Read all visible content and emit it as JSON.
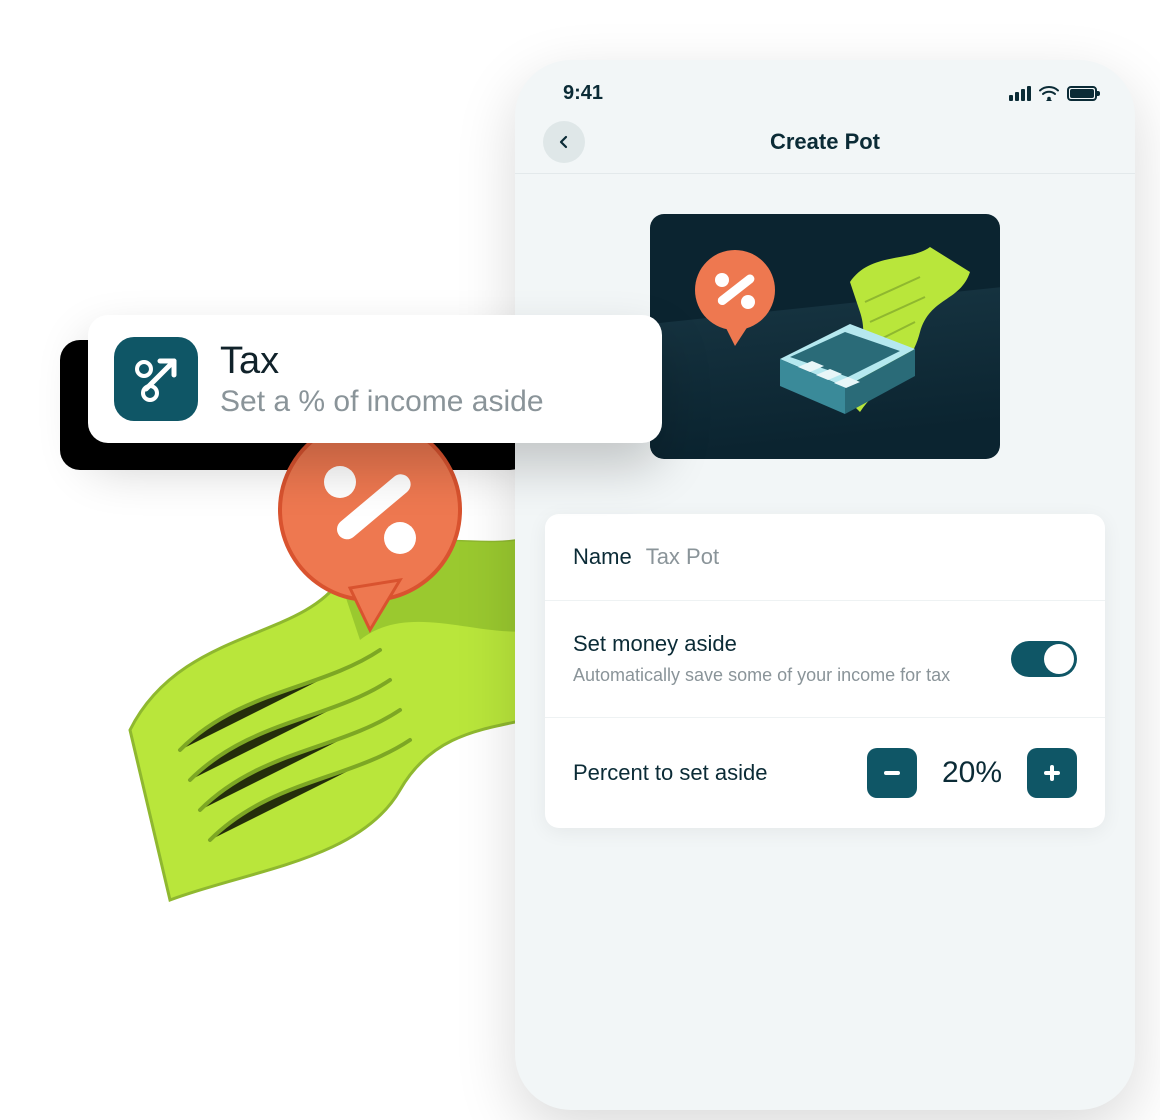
{
  "status": {
    "time": "9:41"
  },
  "nav": {
    "title": "Create Pot"
  },
  "form": {
    "name_label": "Name",
    "name_value": "Tax Pot",
    "aside_title": "Set money aside",
    "aside_sub": "Automatically save some of your income for tax",
    "percent_label": "Percent to set aside",
    "percent_value": "20%"
  },
  "callout": {
    "title": "Tax",
    "subtitle": "Set a % of income aside"
  },
  "colors": {
    "accent": "#0f5666",
    "orange": "#ee7850",
    "lime": "#b9e63b"
  }
}
